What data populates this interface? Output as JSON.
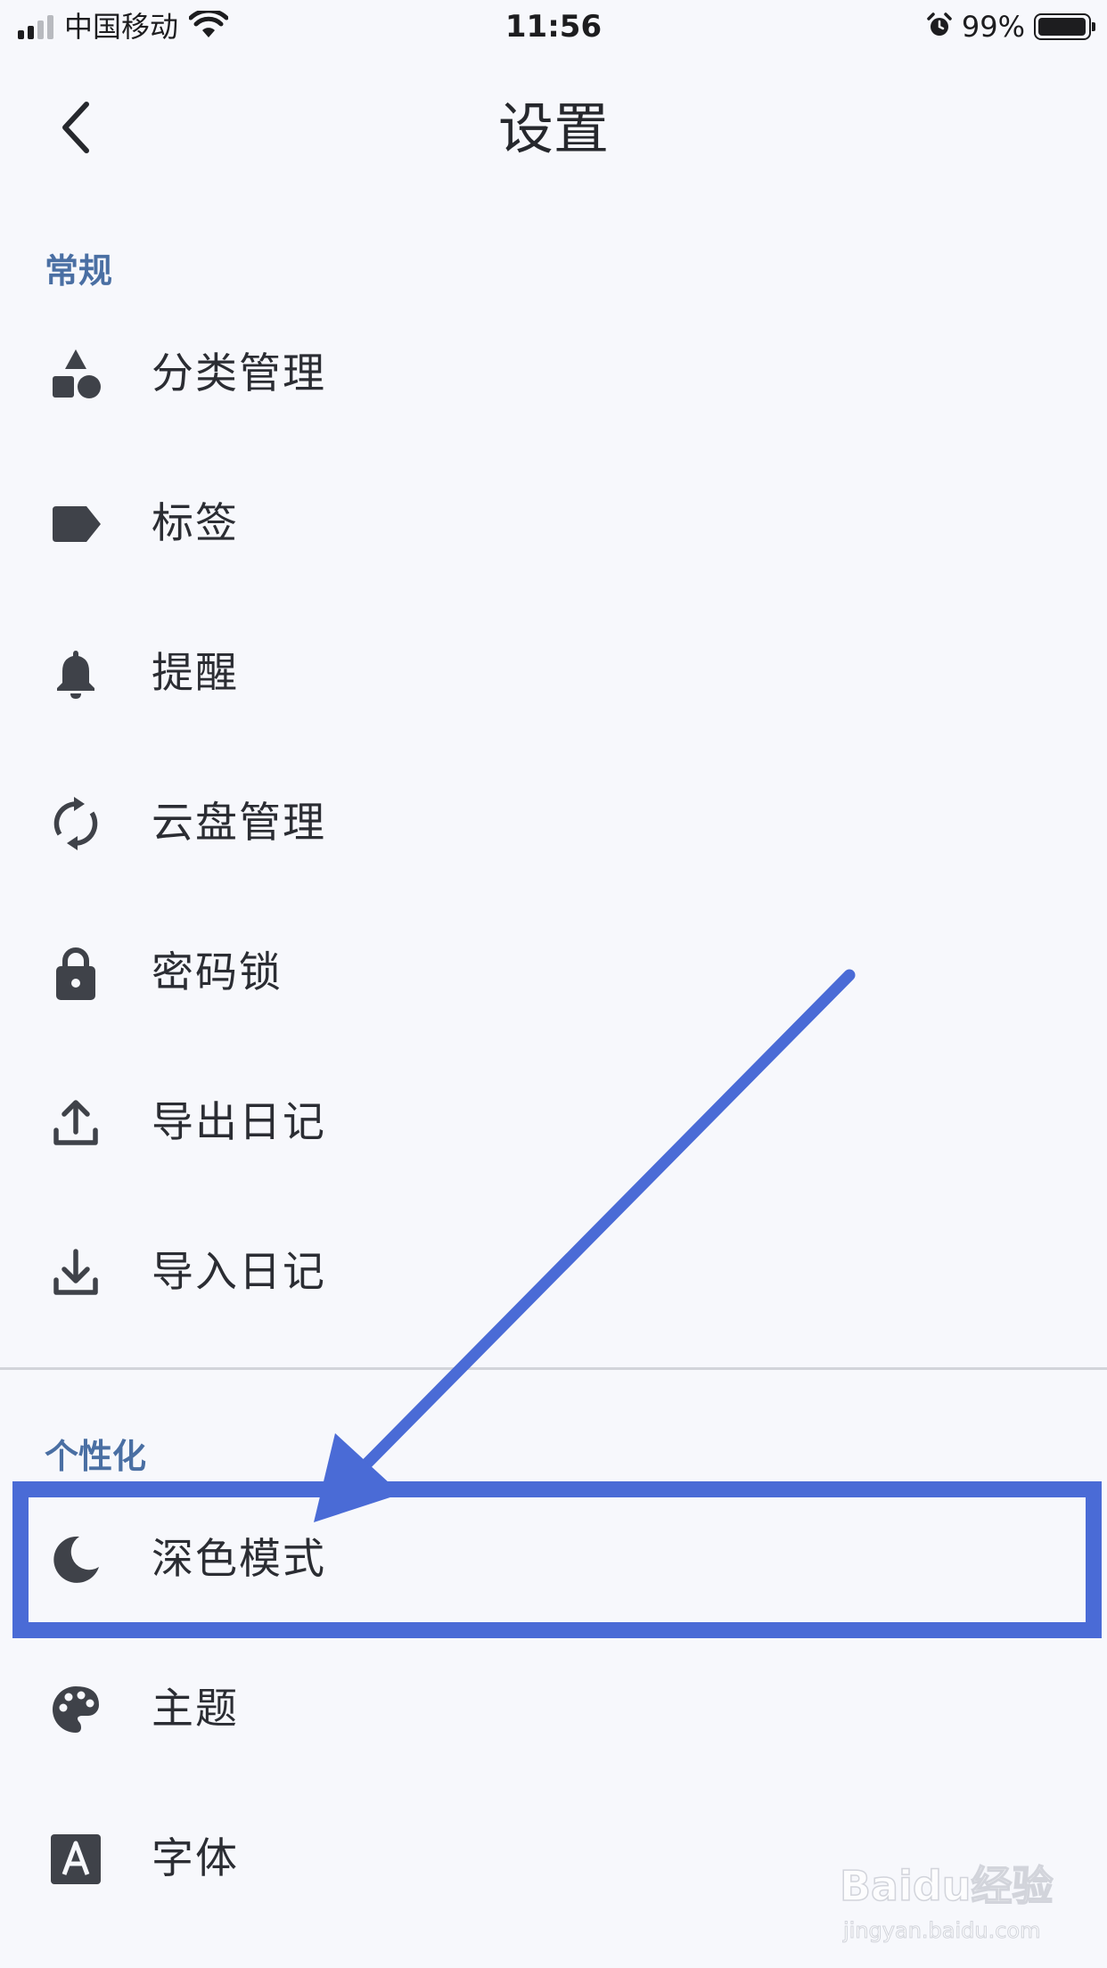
{
  "status_bar": {
    "carrier": "中国移动",
    "time": "11:56",
    "battery_percent": "99%",
    "battery_level": 0.99,
    "signal_bars_filled": 2,
    "icons": [
      "signal-icon",
      "wifi-icon",
      "alarm-icon",
      "battery-icon"
    ]
  },
  "header": {
    "title": "设置",
    "back_icon": "chevron-left-icon"
  },
  "sections": {
    "general": {
      "title": "常规",
      "items": [
        {
          "label": "分类管理",
          "icon": "shapes-icon"
        },
        {
          "label": "标签",
          "icon": "tag-icon"
        },
        {
          "label": "提醒",
          "icon": "bell-icon"
        },
        {
          "label": "云盘管理",
          "icon": "sync-icon"
        },
        {
          "label": "密码锁",
          "icon": "lock-icon"
        },
        {
          "label": "导出日记",
          "icon": "upload-icon"
        },
        {
          "label": "导入日记",
          "icon": "download-icon"
        }
      ]
    },
    "personalization": {
      "title": "个性化",
      "items": [
        {
          "label": "深色模式",
          "icon": "moon-icon"
        },
        {
          "label": "主题",
          "icon": "palette-icon"
        },
        {
          "label": "字体",
          "icon": "font-icon"
        }
      ]
    }
  },
  "annotation": {
    "color": "#4a6bd6",
    "highlighted_item": "深色模式"
  },
  "watermark": {
    "brand": "Baidu经验",
    "url": "jingyan.baidu.com"
  },
  "colors": {
    "background": "#f7f8fc",
    "section_title": "#4a6fa3",
    "icon": "#3f4249",
    "text": "#2b2d33"
  }
}
